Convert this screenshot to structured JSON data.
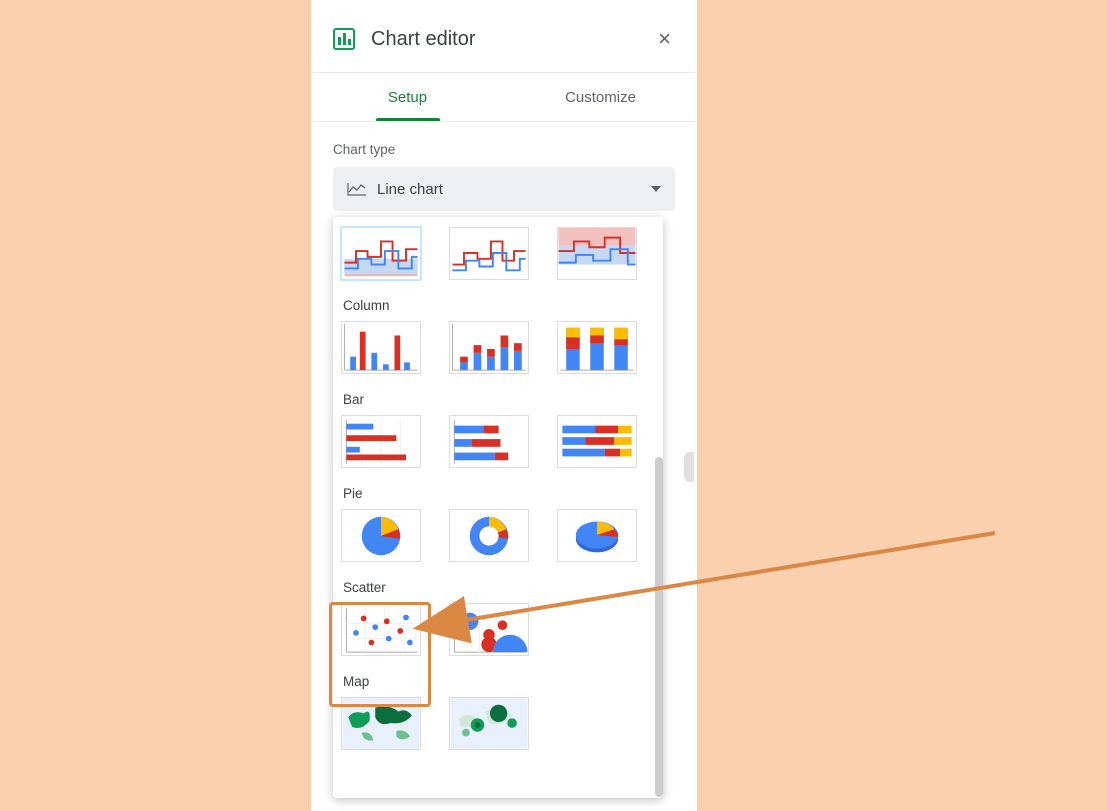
{
  "header": {
    "title": "Chart editor",
    "close_icon": "×"
  },
  "tabs": {
    "setup": "Setup",
    "customize": "Customize",
    "active": "setup"
  },
  "setup": {
    "chart_type_label": "Chart type",
    "selected_chart": "Line chart"
  },
  "dropdown": {
    "sections": {
      "column": "Column",
      "bar": "Bar",
      "pie": "Pie",
      "scatter": "Scatter",
      "map": "Map"
    }
  },
  "accent_color": "#188038",
  "highlight_color": "#db8844"
}
